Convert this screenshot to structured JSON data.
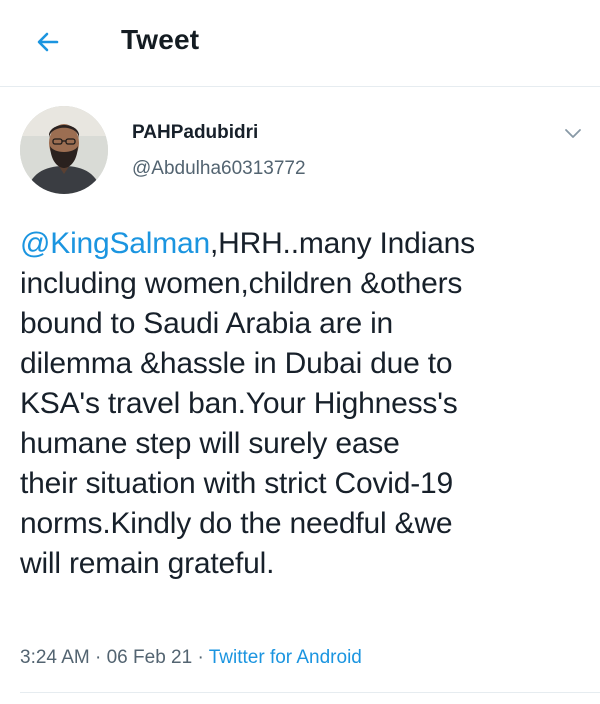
{
  "header": {
    "title": "Tweet",
    "back_icon": "arrow-left-icon",
    "accent_color": "#1b95e0"
  },
  "tweet": {
    "author": {
      "display_name": "PAHPadubidri",
      "handle": "@Abdulha60313772"
    },
    "menu_icon": "chevron-down-icon",
    "mention": "@KingSalman",
    "text_body": ",HRH..many Indians\nincluding women,children &others\nbound to Saudi Arabia are in\ndilemma &hassle in Dubai due to\nKSA's travel ban.Your Highness's\nhumane step will surely ease\ntheir situation with strict Covid-19\nnorms.Kindly do the needful &we\nwill remain grateful.",
    "time": "3:24 AM",
    "separator1": " · ",
    "date": "06 Feb 21",
    "separator2": " · ",
    "source": "Twitter for Android"
  }
}
